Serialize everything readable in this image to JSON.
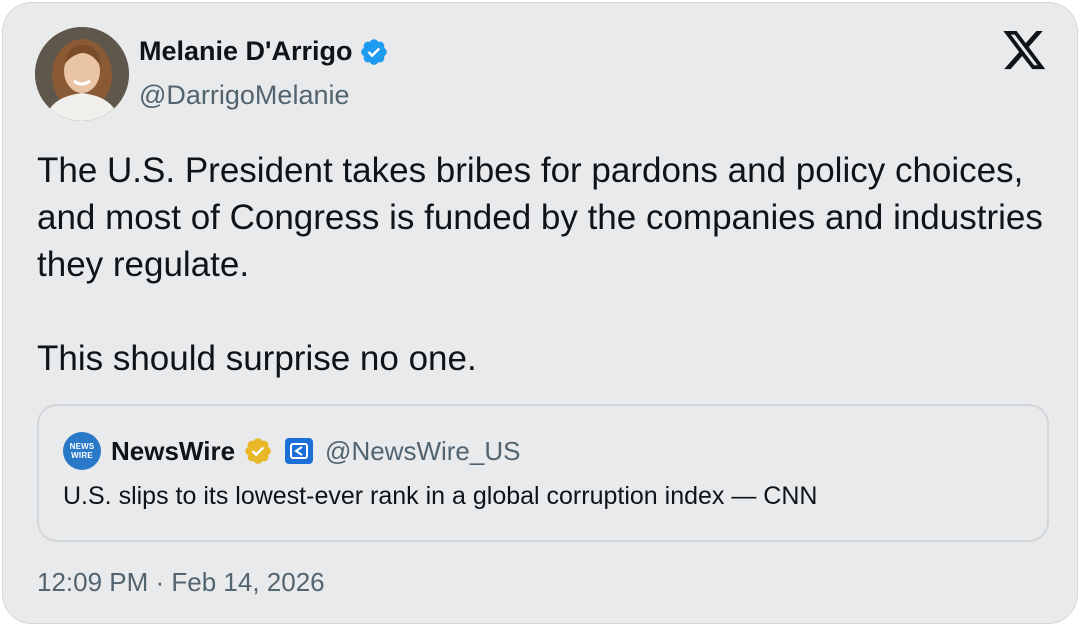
{
  "tweet": {
    "author_name": "Melanie D'Arrigo",
    "author_handle": "@DarrigoMelanie",
    "avatar_icon": "profile-photo-avatar",
    "verified_icon": "blue-verified-badge-icon",
    "platform_icon": "x-logo-icon",
    "text_lines": [
      "The U.S. President takes bribes for pardons and policy choices, and most of Congress is funded by the companies and industries they regulate.",
      "This should surprise no one."
    ],
    "timestamp": "12:09 PM · Feb 14, 2026"
  },
  "quote": {
    "avatar_text_line1": "NEWS",
    "avatar_text_line2": "WIRE",
    "author_name": "NewsWire",
    "author_handle": "@NewsWire_US",
    "badge_icon": "gold-verified-badge-icon",
    "affiliation_icon": "affiliation-icon",
    "text": "U.S. slips to its lowest-ever rank in a global corruption index — CNN"
  },
  "colors": {
    "card_background": "#e9eaeb",
    "primary_text": "#0f1419",
    "secondary_text": "#536471",
    "verified_blue": "#1d9bf0",
    "gold_badge": "#e8b829"
  }
}
